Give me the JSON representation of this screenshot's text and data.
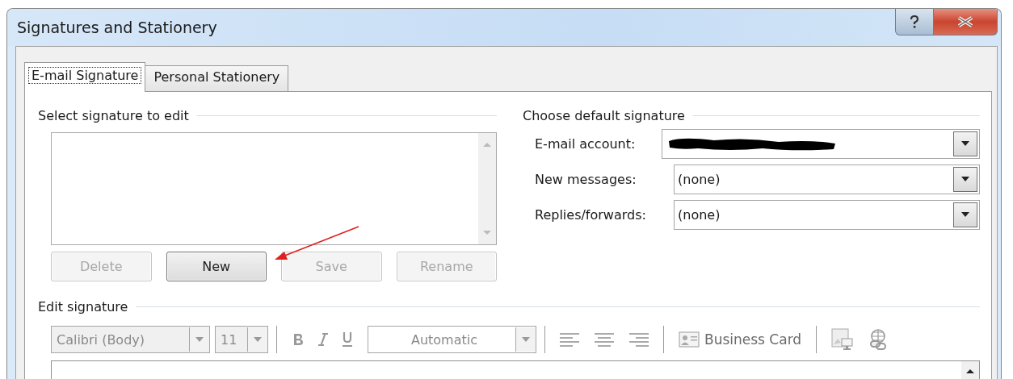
{
  "window": {
    "title": "Signatures and Stationery"
  },
  "tabs": [
    {
      "label": "E-mail Signature",
      "selected": true
    },
    {
      "label": "Personal Stationery",
      "selected": false
    }
  ],
  "select_signature": {
    "title": "Select signature to edit",
    "buttons": [
      {
        "label": "Delete",
        "disabled": true
      },
      {
        "label": "New",
        "disabled": false
      },
      {
        "label": "Save",
        "disabled": true
      },
      {
        "label": "Rename",
        "disabled": true
      }
    ]
  },
  "default_signature": {
    "title": "Choose default signature",
    "fields": [
      {
        "label": "E-mail account:",
        "redacted": true
      },
      {
        "label": "New messages:",
        "value": "(none)"
      },
      {
        "label": "Replies/forwards:",
        "value": "(none)"
      }
    ]
  },
  "edit_signature": {
    "title": "Edit signature",
    "toolbar": {
      "disabled": true,
      "font": "Calibri (Body)",
      "size": "11",
      "font_color_label": "Automatic",
      "business_card": "Business Card"
    }
  }
}
